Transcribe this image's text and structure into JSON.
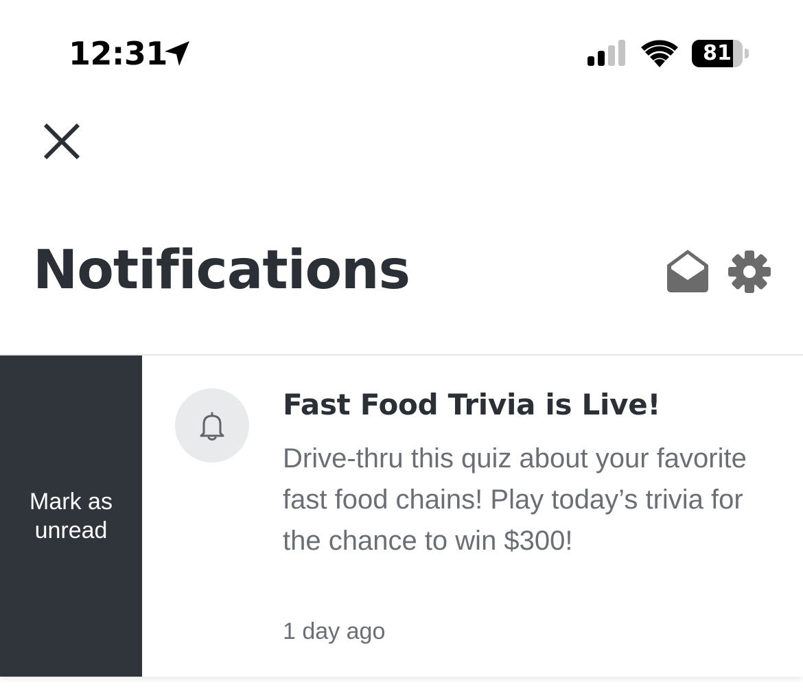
{
  "status_bar": {
    "time": "12:31",
    "battery_percent": "81",
    "battery_level": 0.81,
    "signal_bars_active": 2,
    "signal_bars_total": 4,
    "icons": [
      "location-arrow-icon",
      "cellular-signal-icon",
      "wifi-icon",
      "battery-icon"
    ]
  },
  "header": {
    "close_icon": "close-icon",
    "title": "Notifications",
    "mark_all_read_icon": "open-envelope-icon",
    "settings_icon": "gear-icon"
  },
  "notifications": [
    {
      "icon": "bell-icon",
      "title": "Fast Food Trivia is Live!",
      "body": "Drive-thru this quiz about your favorite fast food chains! Play today’s trivia for the chance to win $300!",
      "time": "1 day ago",
      "swipe_action_label": "Mark as unread"
    }
  ],
  "colors": {
    "text_primary": "#2b2f36",
    "text_secondary": "#6a6e75",
    "swipe_action_bg": "#30343b",
    "icon_grey": "#6b6b6b",
    "icon_circle_bg": "#e9eaec"
  }
}
